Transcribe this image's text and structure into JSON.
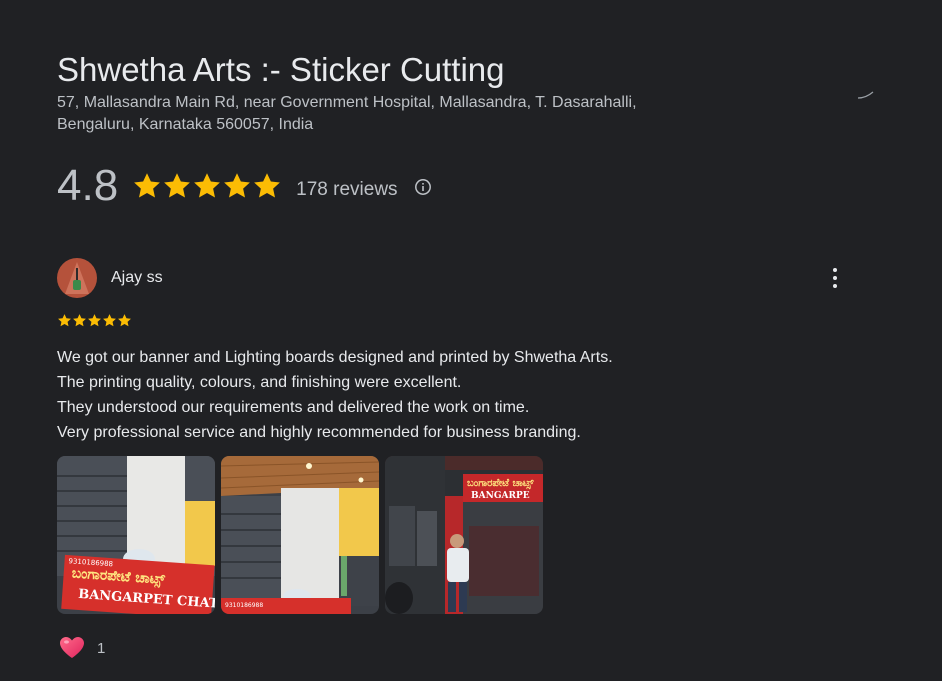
{
  "place": {
    "title": "Shwetha Arts :- Sticker Cutting",
    "address_line1": "57, Mallasandra Main Rd, near Government Hospital, Mallasandra, T. Dasarahalli,",
    "address_line2": "Bengaluru, Karnataka 560057, India"
  },
  "rating": {
    "value": "4.8",
    "stars": 5,
    "review_count": "178 reviews",
    "info_icon": "info-icon"
  },
  "review": {
    "author": "Ajay ss",
    "stars": 5,
    "text_lines": [
      "We got our banner and Lighting boards designed and printed by Shwetha Arts.",
      "The printing quality, colours, and finishing were excellent.",
      "They understood our requirements and delivered the work on time.",
      "Very professional service and highly recommended for business branding."
    ],
    "photo_signs": {
      "kannada_text": "ಬಂಗಾರಪೇಟೆ ಚಾಟ್ಸ್",
      "english_text": "BANGARPET CHATS",
      "phone_text": "9310186988",
      "partial_text": "BANGARPE"
    },
    "reaction": {
      "icon": "heart-icon",
      "count": "1"
    }
  },
  "colors": {
    "background": "#202124",
    "star": "#fbbc04",
    "text_primary": "#e8eaed",
    "text_secondary": "#bdc1c6"
  }
}
